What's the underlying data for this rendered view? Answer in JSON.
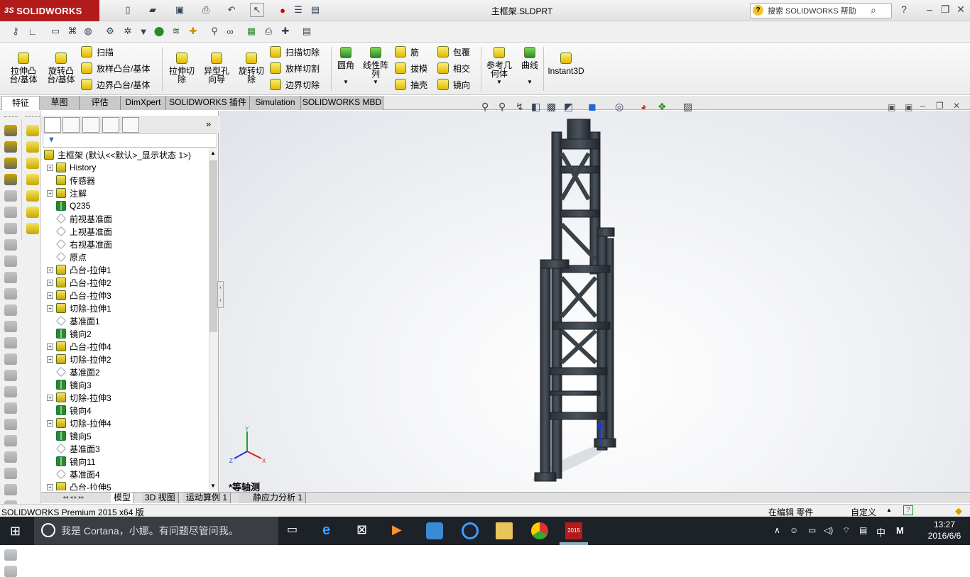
{
  "app": {
    "logo": "SOLIDWORKS",
    "logo_prefix": "3S",
    "document_title": "主框架.SLDPRT"
  },
  "help_search": {
    "placeholder": "搜索 SOLIDWORKS 帮助"
  },
  "ribbon": {
    "big_buttons": [
      {
        "label": "拉伸凸\n台/基体",
        "icon": "extruded-boss-icon"
      },
      {
        "label": "旋转凸\n台/基体",
        "icon": "revolved-boss-icon"
      },
      {
        "label": "拉伸切\n除",
        "icon": "extruded-cut-icon"
      },
      {
        "label": "异型孔\n向导",
        "icon": "hole-wizard-icon"
      },
      {
        "label": "旋转切\n除",
        "icon": "revolved-cut-icon"
      },
      {
        "label": "圆角",
        "icon": "fillet-icon"
      },
      {
        "label": "线性阵\n列",
        "icon": "linear-pattern-icon"
      },
      {
        "label": "参考几\n何体",
        "icon": "reference-geometry-icon"
      },
      {
        "label": "曲线",
        "icon": "curves-icon"
      },
      {
        "label": "Instant3D",
        "icon": "instant3d-icon"
      }
    ],
    "small_buttons": [
      {
        "label": "扫描"
      },
      {
        "label": "放样凸台/基体"
      },
      {
        "label": "边界凸台/基体"
      },
      {
        "label": "扫描切除"
      },
      {
        "label": "放样切割"
      },
      {
        "label": "边界切除"
      },
      {
        "label": "筋"
      },
      {
        "label": "拔模"
      },
      {
        "label": "抽壳"
      },
      {
        "label": "包覆"
      },
      {
        "label": "相交"
      },
      {
        "label": "镜向"
      }
    ]
  },
  "command_tabs": [
    "特征",
    "草图",
    "评估",
    "DimXpert",
    "SOLIDWORKS 插件",
    "Simulation",
    "SOLIDWORKS MBD"
  ],
  "tree": {
    "root": "主框架  (默认<<默认>_显示状态 1>)",
    "items": [
      {
        "label": "History",
        "expand": true,
        "kind": "history"
      },
      {
        "label": "传感器",
        "expand": false,
        "kind": "sensor"
      },
      {
        "label": "注解",
        "expand": true,
        "kind": "annotation"
      },
      {
        "label": "Q235",
        "expand": false,
        "kind": "material"
      },
      {
        "label": "前视基准面",
        "expand": false,
        "kind": "plane"
      },
      {
        "label": "上视基准面",
        "expand": false,
        "kind": "plane"
      },
      {
        "label": "右视基准面",
        "expand": false,
        "kind": "plane"
      },
      {
        "label": "原点",
        "expand": false,
        "kind": "origin"
      },
      {
        "label": "凸台-拉伸1",
        "expand": true,
        "kind": "feat"
      },
      {
        "label": "凸台-拉伸2",
        "expand": true,
        "kind": "feat"
      },
      {
        "label": "凸台-拉伸3",
        "expand": true,
        "kind": "feat"
      },
      {
        "label": "切除-拉伸1",
        "expand": true,
        "kind": "feat"
      },
      {
        "label": "基准面1",
        "expand": false,
        "kind": "plane"
      },
      {
        "label": "镜向2",
        "expand": false,
        "kind": "mirror"
      },
      {
        "label": "凸台-拉伸4",
        "expand": true,
        "kind": "feat"
      },
      {
        "label": "切除-拉伸2",
        "expand": true,
        "kind": "feat"
      },
      {
        "label": "基准面2",
        "expand": false,
        "kind": "plane"
      },
      {
        "label": "镜向3",
        "expand": false,
        "kind": "mirror"
      },
      {
        "label": "切除-拉伸3",
        "expand": true,
        "kind": "feat"
      },
      {
        "label": "镜向4",
        "expand": false,
        "kind": "mirror"
      },
      {
        "label": "切除-拉伸4",
        "expand": true,
        "kind": "feat"
      },
      {
        "label": "镜向5",
        "expand": false,
        "kind": "mirror"
      },
      {
        "label": "基准面3",
        "expand": false,
        "kind": "plane"
      },
      {
        "label": "镜向11",
        "expand": false,
        "kind": "mirror"
      },
      {
        "label": "基准面4",
        "expand": false,
        "kind": "plane"
      },
      {
        "label": "凸台-拉伸5",
        "expand": true,
        "kind": "feat"
      }
    ]
  },
  "viewport": {
    "view_name": "*等轴测",
    "triad": {
      "x": "X",
      "y": "Y",
      "z": "Z"
    }
  },
  "bottom_tabs": [
    "模型",
    "3D 视图",
    "运动算例 1",
    "静应力分析 1"
  ],
  "status": {
    "left": "SOLIDWORKS Premium 2015 x64 版",
    "mode": "在编辑 零件",
    "units": "自定义"
  },
  "taskbar": {
    "search_placeholder": "我是 Cortana，小娜。有问题尽管问我。",
    "ime_lang": "中",
    "ime_mode": "M",
    "time": "13:27",
    "date": "2016/6/6",
    "sw_badge": "2015"
  },
  "colors": {
    "brand_red": "#b31b1b",
    "taskbar": "#1d2128",
    "frame": "#333a42"
  }
}
